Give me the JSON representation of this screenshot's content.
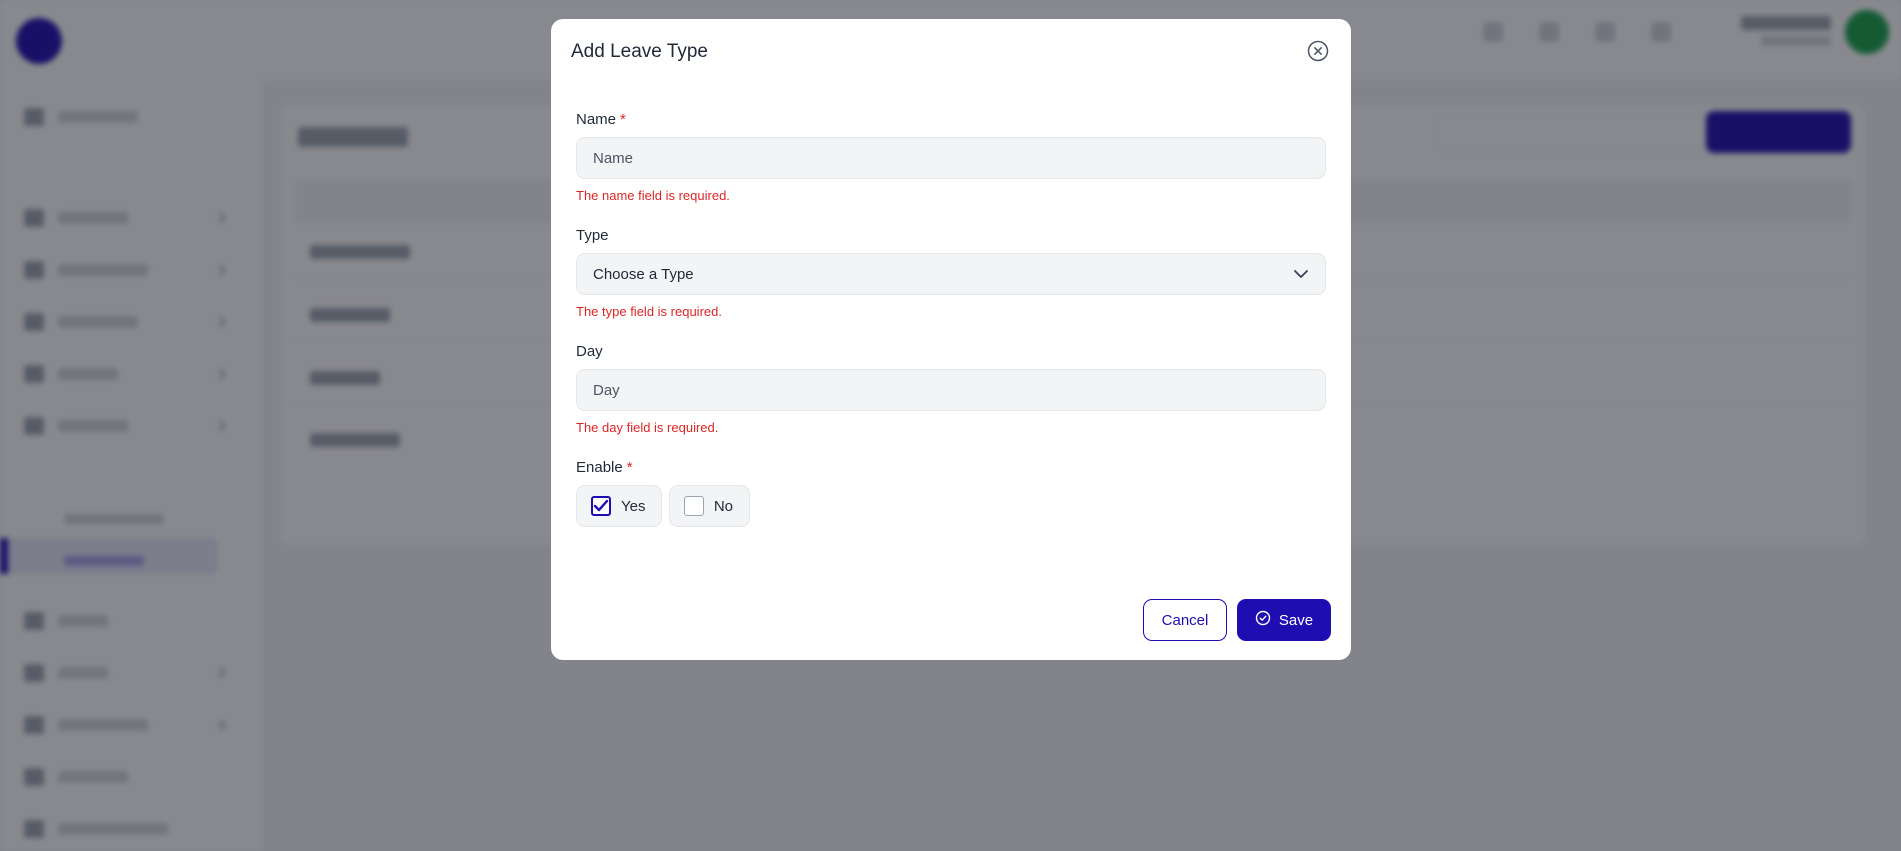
{
  "background": {
    "sidebar_items": [
      "",
      "",
      "",
      "",
      "",
      "",
      ""
    ]
  },
  "modal": {
    "title": "Add Leave Type",
    "fields": {
      "name": {
        "label": "Name",
        "required_mark": "*",
        "placeholder": "Name",
        "value": "",
        "error": "The name field is required."
      },
      "type": {
        "label": "Type",
        "selected": "Choose a Type",
        "error": "The type field is required."
      },
      "day": {
        "label": "Day",
        "placeholder": "Day",
        "value": "",
        "error": "The day field is required."
      },
      "enable": {
        "label": "Enable",
        "required_mark": "*",
        "options": [
          {
            "label": "Yes",
            "checked": true
          },
          {
            "label": "No",
            "checked": false
          }
        ]
      }
    },
    "buttons": {
      "cancel": "Cancel",
      "save": "Save"
    }
  },
  "colors": {
    "primary": "#1e0db0",
    "error": "#dc2626",
    "input_bg": "#f3f4f6",
    "overlay": "rgba(17,20,29,0.5)"
  },
  "icons": {
    "close": "close-circle-icon",
    "chevron": "chevron-down-icon",
    "save": "check-circle-icon",
    "checkbox_checked": "checkbox-checked-icon"
  }
}
